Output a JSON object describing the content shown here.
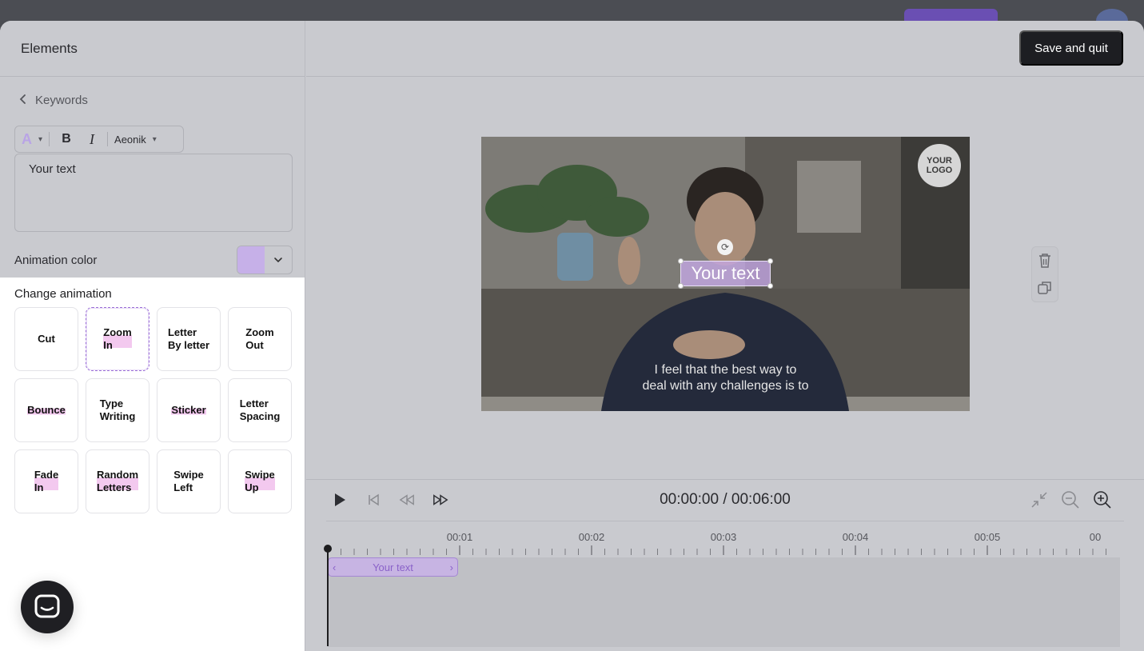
{
  "panel": {
    "title": "Elements",
    "back_label": "Keywords",
    "toolbar": {
      "color_glyph": "A",
      "bold_glyph": "B",
      "italic_glyph": "I",
      "font_name": "Aeonik"
    },
    "text_value": "Your text",
    "animation_color_label": "Animation color",
    "animation_color": "#c6b0e8"
  },
  "animations": {
    "title": "Change animation",
    "selected": "Zoom In",
    "items": [
      {
        "label": "Cut",
        "highlight": false
      },
      {
        "label": "Zoom\nIn",
        "highlight": true
      },
      {
        "label": "Letter\nBy letter",
        "highlight": false
      },
      {
        "label": "Zoom\nOut",
        "highlight": false
      },
      {
        "label": "Bounce",
        "highlight": true
      },
      {
        "label": "Type\nWriting",
        "highlight": false
      },
      {
        "label": "Sticker",
        "highlight": true
      },
      {
        "label": "Letter\nSpacing",
        "highlight": false
      },
      {
        "label": "Fade\nIn",
        "highlight": true
      },
      {
        "label": "Random\nLetters",
        "highlight": true
      },
      {
        "label": "Swipe\nLeft",
        "highlight": false
      },
      {
        "label": "Swipe\nUp",
        "highlight": true
      }
    ]
  },
  "header": {
    "save_label": "Save and quit"
  },
  "video": {
    "logo_text": "YOUR\nLOGO",
    "overlay_text": "Your text",
    "subtitle_lines": [
      "I feel that the best way to",
      "deal with any challenges is to"
    ]
  },
  "timeline": {
    "time_readout": "00:00:00 / 00:06:00",
    "ticks": [
      "00:01",
      "00:02",
      "00:03",
      "00:04",
      "00:05",
      "00"
    ],
    "clip_label": "Your text"
  },
  "colors": {
    "accent": "#9b6fd6",
    "dark_button": "#1d1e22"
  }
}
